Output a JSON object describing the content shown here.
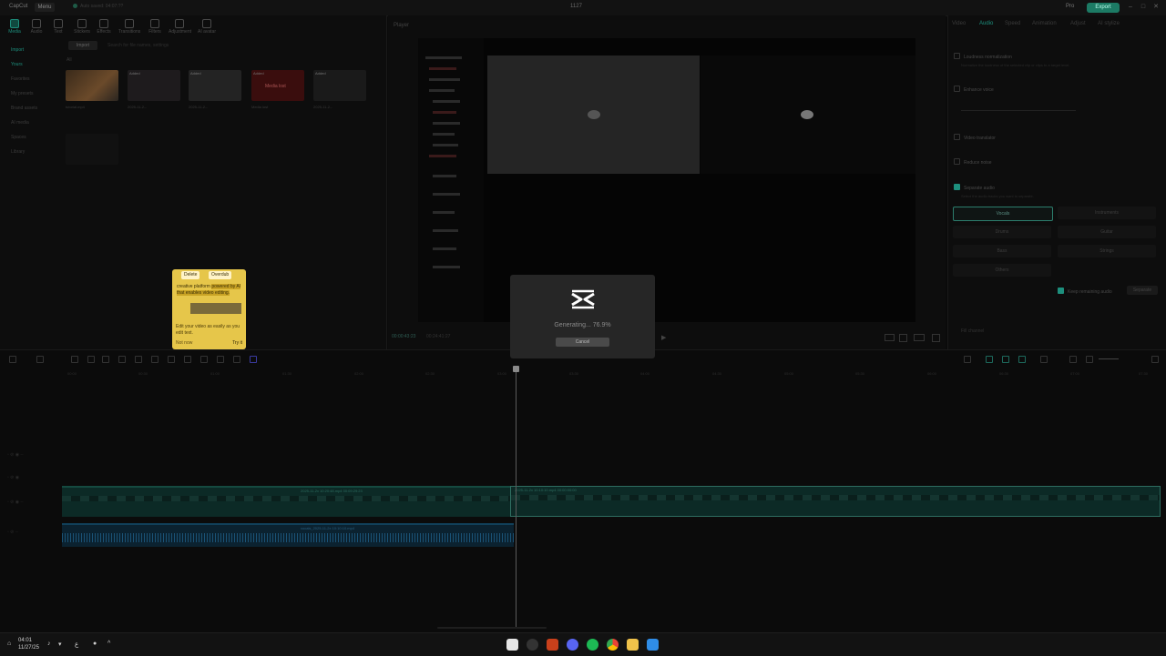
{
  "titlebar": {
    "app_name": "CapCut",
    "menu_label": "Menu",
    "autosave": "Auto saved: 04:07:??",
    "project_name": "1127",
    "pro_label": "Pro",
    "export_label": "Export"
  },
  "media_toolbar": [
    {
      "label": "Media",
      "icon": "media-icon"
    },
    {
      "label": "Audio",
      "icon": "audio-icon"
    },
    {
      "label": "Text",
      "icon": "text-icon"
    },
    {
      "label": "Stickers",
      "icon": "stickers-icon"
    },
    {
      "label": "Effects",
      "icon": "effects-icon"
    },
    {
      "label": "Transitions",
      "icon": "transitions-icon"
    },
    {
      "label": "Filters",
      "icon": "filters-icon"
    },
    {
      "label": "Adjustment",
      "icon": "adjustment-icon"
    },
    {
      "label": "AI avatar",
      "icon": "ai-avatar-icon"
    }
  ],
  "sidenav": [
    "Import",
    "Yours",
    "Favorites",
    "My presets",
    "Brand assets",
    "AI media",
    "Spaces",
    "Library"
  ],
  "media": {
    "import_label": "Import",
    "search_placeholder": "Search for file names, settings",
    "all_label": "All",
    "thumb_captions": [
      "tutorial.mp4",
      "2025-11-2...",
      "2025-11-2...",
      "Media lost",
      "2025-11-2..."
    ],
    "tags": [
      "Added",
      "Added",
      "Added",
      "Added"
    ],
    "media_lost": "Media lost"
  },
  "popup": {
    "delete_label": "Delete",
    "overdub_label": "Overdub",
    "text_a": "creative platform ",
    "text_b": "powered by AI that enables video editing.",
    "footer": "Edit your video as easily as you edit text.",
    "later": "Not now",
    "try": "Try it"
  },
  "player": {
    "label": "Player",
    "timecode_current": "00:00:43:23",
    "timecode_total": "00:24:41:27"
  },
  "right_panel": {
    "tabs": [
      "Video",
      "Audio",
      "Speed",
      "Animation",
      "Adjust",
      "AI stylize"
    ],
    "loudness": "Loudness normalization",
    "loudness_sub": "Normalize the loudness of the selected clip or clips to a target level.",
    "enhance": "Enhance voice",
    "translator": "Video translator",
    "reduce_noise": "Reduce noise",
    "separate_audio": "Separate audio",
    "separate_sub": "Select the audio tracks you want to separate.",
    "options": [
      "Vocals",
      "Instruments",
      "Drums",
      "Guitar",
      "Bass",
      "Strings",
      "Others"
    ],
    "keep_remaining": "Keep remaining audio",
    "separate_btn": "Separate",
    "fill_channel": "Fill channel"
  },
  "dialog": {
    "status": "Generating... 76.9%",
    "progress": 76.9,
    "cancel_label": "Cancel"
  },
  "timeline": {
    "ruler": [
      "00:00",
      "00:30",
      "01:00",
      "01:30",
      "02:00",
      "02:30",
      "03:00",
      "03:30",
      "04:00",
      "04:30",
      "05:00",
      "05:30",
      "06:00",
      "06:30",
      "07:00",
      "07:30"
    ],
    "clip1_label": "2025-11-2x 10:20:48.mp4   00:09:29:23",
    "clip2_label": "2025-11-2x 10:10:10.mp4   00:00:00:00",
    "audio_label": "vocals_2025-11-2x 10:10:10.mp4"
  },
  "taskbar": {
    "time": "04:01",
    "date": "11/27/25"
  }
}
